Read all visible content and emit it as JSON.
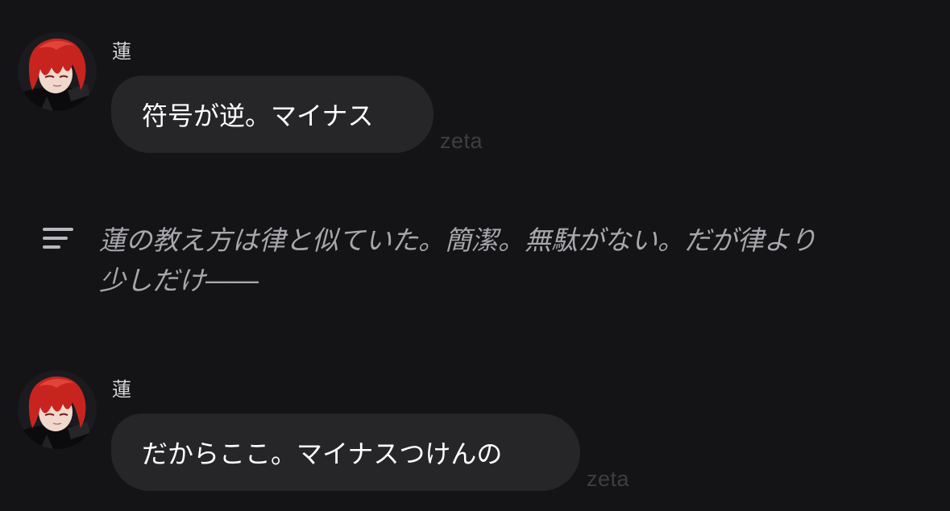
{
  "messages": [
    {
      "sender": "蓮",
      "text": "符号が逆。マイナス",
      "brand": "zeta",
      "avatar_icon": "character-avatar-red-hair"
    },
    {
      "sender": "蓮",
      "text": "だからここ。マイナスつけんの",
      "brand": "zeta",
      "avatar_icon": "character-avatar-red-hair"
    }
  ],
  "narration": {
    "icon": "menu-lines-icon",
    "text": "蓮の教え方は律と似ていた。簡潔。無駄がない。だが律より\n少しだけ――"
  },
  "colors": {
    "background": "#141316",
    "bubble": "#262629",
    "narration_text": "#a8a8ac",
    "brand_text": "#3e3e42",
    "avatar_hair": "#c8241f"
  }
}
